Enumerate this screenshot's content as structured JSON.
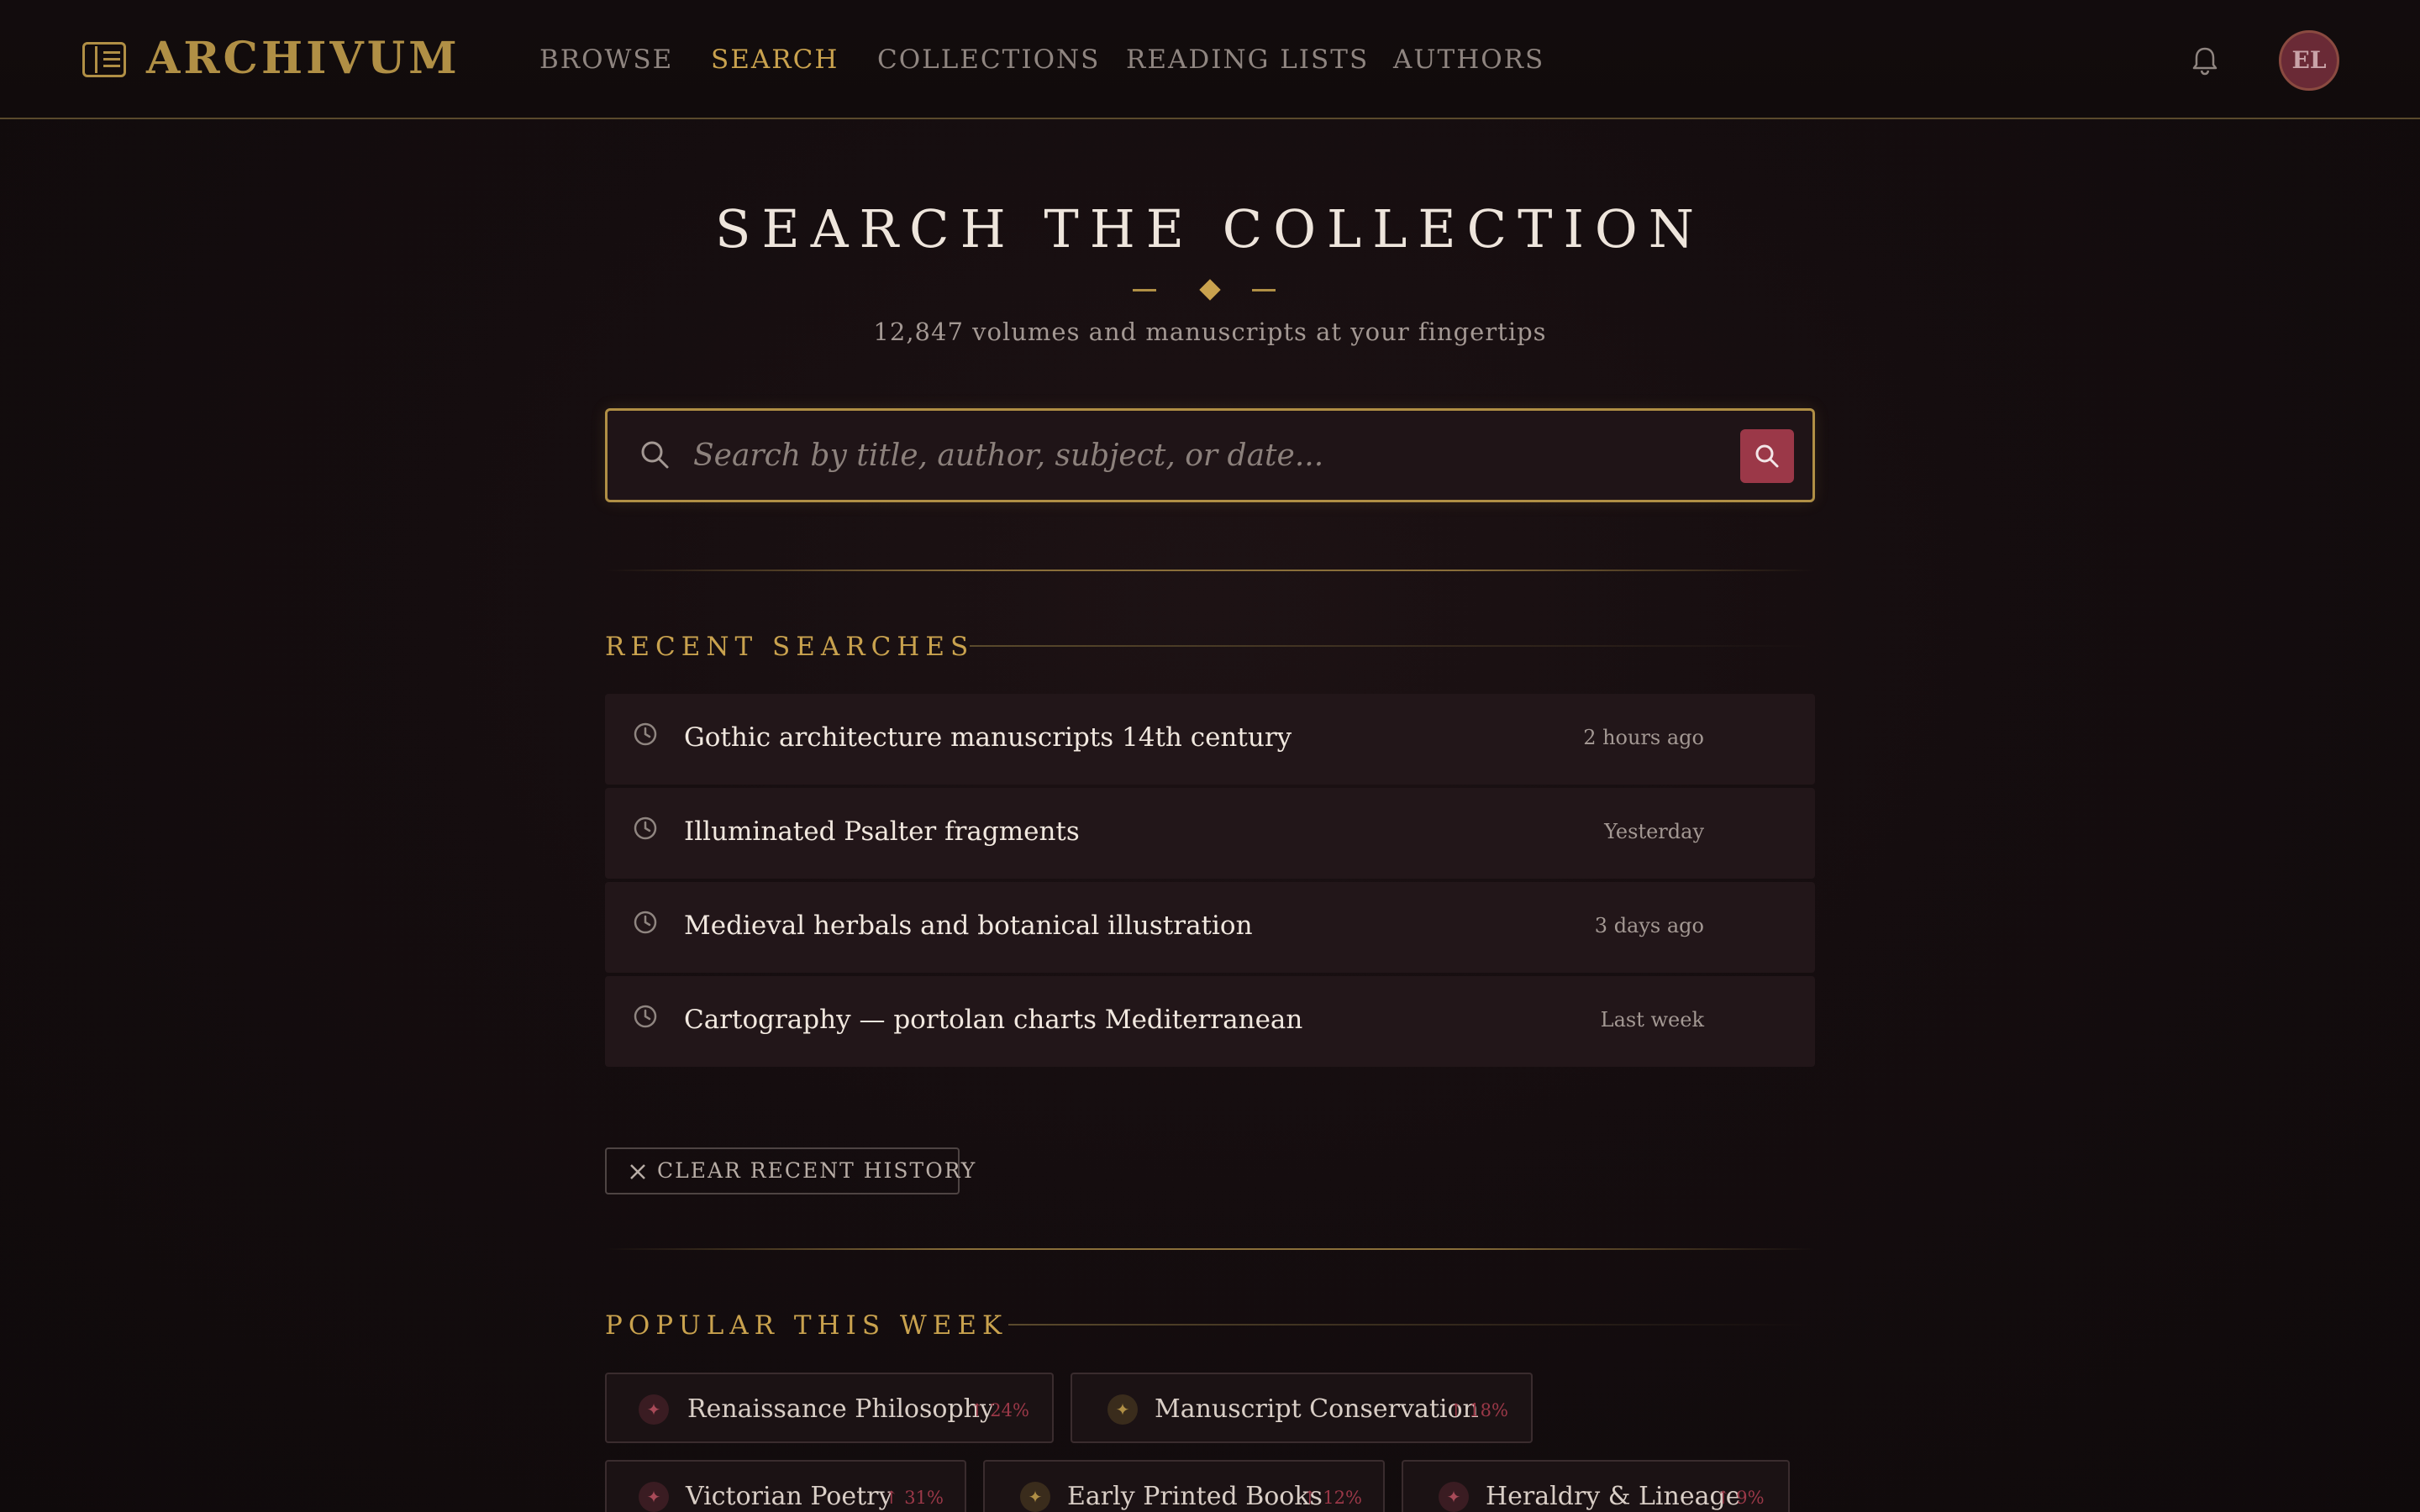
{
  "header": {
    "logo_text": "ARCHIVUM",
    "nav": [
      "Browse",
      "Search",
      "Collections",
      "Reading Lists",
      "Authors"
    ],
    "active_nav": "Search",
    "avatar_initials": "EL"
  },
  "hero": {
    "title": "SEARCH THE COLLECTION",
    "subtitle": "12,847 volumes and manuscripts at your fingertips"
  },
  "search": {
    "placeholder": "Search by title, author, subject, or date...",
    "value": ""
  },
  "recent": {
    "title": "RECENT SEARCHES",
    "items": [
      {
        "query": "Gothic architecture manuscripts 14th century",
        "time": "2 hours ago"
      },
      {
        "query": "Illuminated Psalter fragments",
        "time": "Yesterday"
      },
      {
        "query": "Medieval herbals and botanical illustration",
        "time": "3 days ago"
      },
      {
        "query": "Cartography — portolan charts Mediterranean",
        "time": "Last week"
      }
    ],
    "clear_label": "CLEAR RECENT HISTORY"
  },
  "popular": {
    "title": "POPULAR THIS WEEK",
    "chips": [
      {
        "label": "Renaissance Philosophy",
        "trend": "↑ 24%",
        "accent": "crimson"
      },
      {
        "label": "Manuscript Conservation",
        "trend": "↑ 18%",
        "accent": "gold"
      },
      {
        "label": "Victorian Poetry",
        "trend": "↑ 31%",
        "accent": "crimson"
      },
      {
        "label": "Early Printed Books",
        "trend": "↑ 12%",
        "accent": "gold"
      },
      {
        "label": "Heraldry & Lineage",
        "trend": "↑ 9%",
        "accent": "crimson"
      }
    ]
  },
  "colors": {
    "gold": "#c9a24e",
    "crimson": "#9b3848",
    "background": "#150d0f"
  }
}
